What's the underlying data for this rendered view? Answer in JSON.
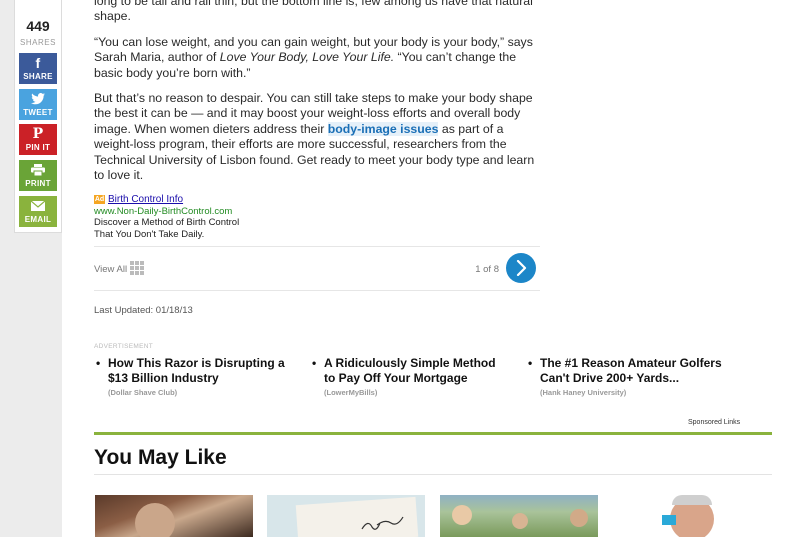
{
  "share": {
    "count": "449",
    "count_label": "SHARES",
    "buttons": [
      {
        "label": "SHARE",
        "icon": "facebook-icon",
        "color": "#3b5a9a"
      },
      {
        "label": "TWEET",
        "icon": "twitter-icon",
        "color": "#4aa3df"
      },
      {
        "label": "PIN IT",
        "icon": "pinterest-icon",
        "color": "#cb2127"
      },
      {
        "label": "PRINT",
        "icon": "print-icon",
        "color": "#6aa437"
      },
      {
        "label": "EMAIL",
        "icon": "email-icon",
        "color": "#8ab33d"
      }
    ]
  },
  "article": {
    "p1_tail": "long to be tall and rail thin, but the bottom line is, few among us have that natural shape.",
    "p2_a": "“You can lose weight, and you can gain weight, but your body is your body,” says Sarah Maria, author of ",
    "p2_book": "Love Your Body, Love Your Life.",
    "p2_b": " “You can’t change the basic body you’re born with.”",
    "p3_a": "But that’s no reason to despair. You can still take steps to make your body shape the best it can be — and it may boost your weight-loss efforts and overall body image. When women dieters address their ",
    "p3_link": "body-image issues",
    "p3_b": " as part of a weight-loss program, their efforts are more successful, researchers from the Technical University of Lisbon found. Get ready to meet your body type and learn to love it."
  },
  "ad": {
    "badge": "Ad",
    "title": "Birth Control Info",
    "url": "www.Non-Daily-BirthControl.com",
    "desc1": "Discover a Method of Birth Control",
    "desc2": "That You Don't Take Daily."
  },
  "pager": {
    "view_all": "View All",
    "page": "1 of 8"
  },
  "last_updated": "Last Updated: 01/18/13",
  "promos": {
    "label": "ADVERTISEMENT",
    "items": [
      {
        "title": "How This Razor is Disrupting a $13 Billion Industry",
        "source": "(Dollar Shave Club)"
      },
      {
        "title": "A Ridiculously Simple Method to Pay Off Your Mortgage",
        "source": "(LowerMyBills)"
      },
      {
        "title": "The #1 Reason Amateur Golfers Can't Drive 200+ Yards...",
        "source": "(Hank Haney University)"
      }
    ],
    "sponsored": "Sponsored Links"
  },
  "you_may_like": {
    "title": "You May Like"
  }
}
